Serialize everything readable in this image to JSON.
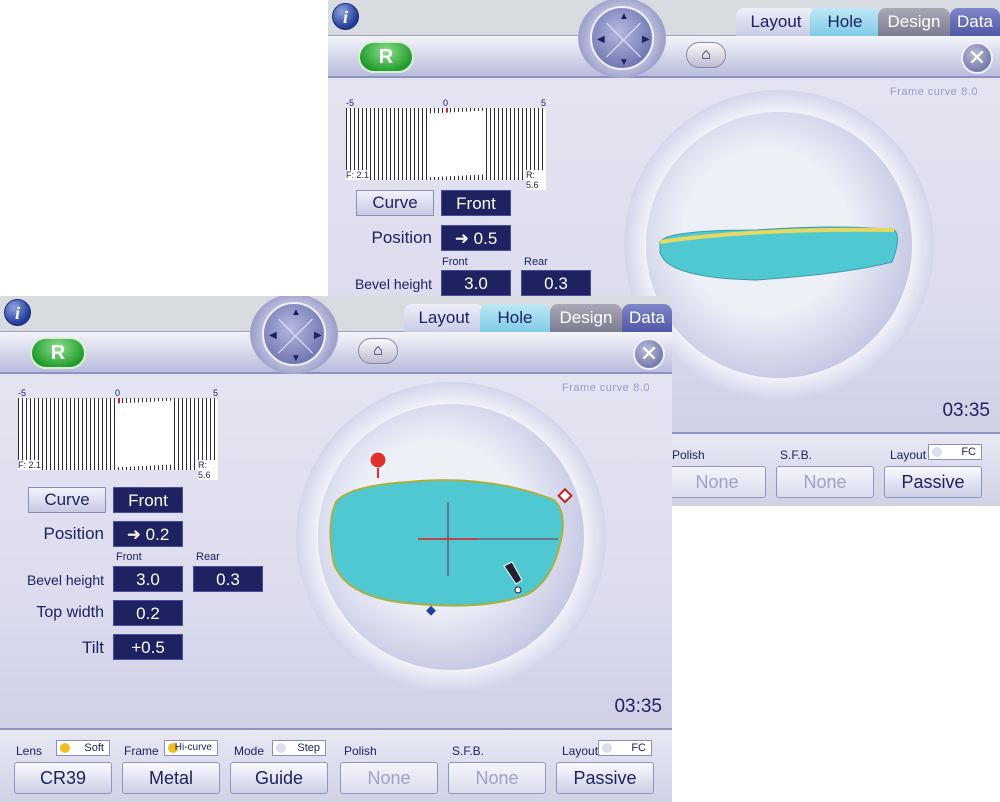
{
  "back": {
    "tabs": {
      "layout": "Layout",
      "hole": "Hole",
      "design": "Design",
      "data": "Data"
    },
    "r_label": "R",
    "frame_curve": {
      "label": "Frame curve",
      "value": "8.0"
    },
    "scale": {
      "min": "-5",
      "zero": "0",
      "max": "5",
      "f": "F: 2.1",
      "r": "R: 5.6"
    },
    "curve": {
      "label": "Curve",
      "value": "Front"
    },
    "position": {
      "label": "Position",
      "value": "➜ 0.5"
    },
    "bevel": {
      "label": "Bevel height",
      "front_hdr": "Front",
      "rear_hdr": "Rear",
      "front": "3.0",
      "rear": "0.3"
    },
    "time": "03:35",
    "bottom": {
      "polish": {
        "label": "Polish",
        "value": "None"
      },
      "sfb": {
        "label": "S.F.B.",
        "value": "None"
      },
      "layout": {
        "label": "Layout",
        "toggle": "FC",
        "value": "Passive"
      }
    }
  },
  "front": {
    "tabs": {
      "layout": "Layout",
      "hole": "Hole",
      "design": "Design",
      "data": "Data"
    },
    "r_label": "R",
    "frame_curve": {
      "label": "Frame curve",
      "value": "8.0"
    },
    "scale": {
      "min": "-5",
      "zero": "0",
      "max": "5",
      "f": "F: 2.1",
      "r": "R: 5.6"
    },
    "curve": {
      "label": "Curve",
      "value": "Front"
    },
    "position": {
      "label": "Position",
      "value": "➜ 0.2"
    },
    "bevel": {
      "label": "Bevel height",
      "front_hdr": "Front",
      "rear_hdr": "Rear",
      "front": "3.0",
      "rear": "0.3"
    },
    "top_width": {
      "label": "Top width",
      "value": "0.2"
    },
    "tilt": {
      "label": "Tilt",
      "value": "+0.5"
    },
    "time": "03:35",
    "bottom": {
      "lens": {
        "label": "Lens",
        "toggle": "Soft",
        "value": "CR39"
      },
      "frame": {
        "label": "Frame",
        "toggle": "Hi-curve",
        "value": "Metal"
      },
      "mode": {
        "label": "Mode",
        "toggle": "Step",
        "value": "Guide"
      },
      "polish": {
        "label": "Polish",
        "value": "None"
      },
      "sfb": {
        "label": "S.F.B.",
        "value": "None"
      },
      "layout": {
        "label": "Layout",
        "toggle": "FC",
        "value": "Passive"
      }
    }
  },
  "colors": {
    "lens_fill": "#4fc8d2",
    "toggle_on": "#f0c020",
    "value_bg": "#1e2260"
  }
}
